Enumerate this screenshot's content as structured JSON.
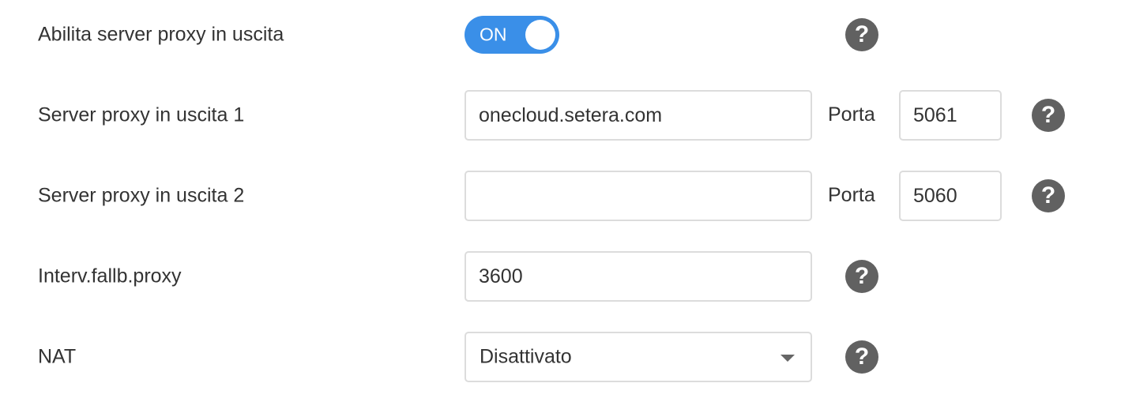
{
  "outbound_proxy": {
    "label": "Abilita server proxy in uscita",
    "toggle_text": "ON",
    "state": "on",
    "help": "?"
  },
  "proxy1": {
    "label": "Server proxy in uscita 1",
    "value": "onecloud.setera.com",
    "port_label": "Porta",
    "port_value": "5061",
    "help": "?"
  },
  "proxy2": {
    "label": "Server proxy in uscita 2",
    "value": "",
    "port_label": "Porta",
    "port_value": "5060",
    "help": "?"
  },
  "fallback": {
    "label": "Interv.fallb.proxy",
    "value": "3600",
    "help": "?"
  },
  "nat": {
    "label": "NAT",
    "selected": "Disattivato",
    "help": "?"
  },
  "colors": {
    "toggle_on": "#3a8fe8",
    "help_icon": "#616161",
    "border": "#dcdcdc",
    "text": "#333333"
  },
  "icons": {
    "help": "question-circle-icon",
    "dropdown": "caret-down-icon"
  }
}
